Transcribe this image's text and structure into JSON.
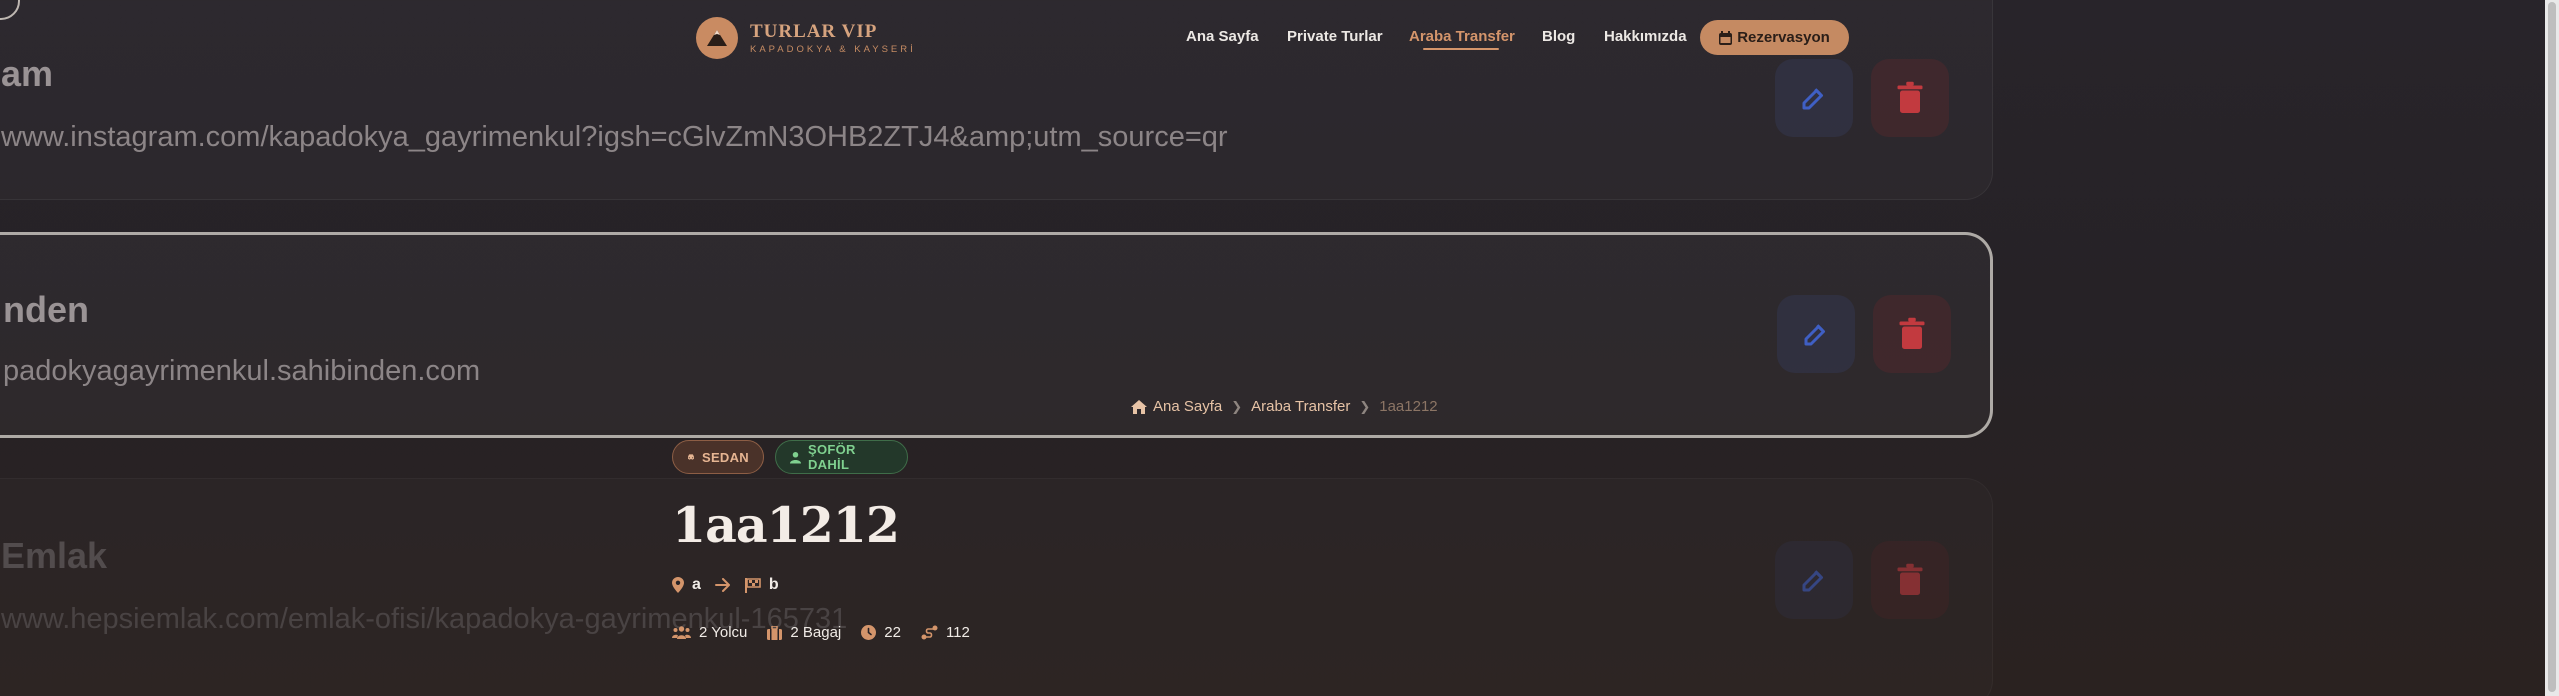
{
  "background_cards": [
    {
      "title": "am",
      "url": "www.instagram.com/kapadokya_gayrimenkul?igsh=cGlvZmN3OHB2ZTJ4&amp;utm_source=qr"
    },
    {
      "title": "nden",
      "url": "padokyagayrimenkul.sahibinden.com"
    },
    {
      "title": "Emlak",
      "url": "www.hepsiemlak.com/emlak-ofisi/kapadokya-gayrimenkul-165731"
    }
  ],
  "brand": {
    "title": "TURLAR VIP",
    "subtitle": "KAPADOKYA & KAYSERİ"
  },
  "nav": {
    "items": [
      {
        "label": "Ana Sayfa"
      },
      {
        "label": "Private Turlar"
      },
      {
        "label": "Araba Transfer"
      },
      {
        "label": "Blog"
      },
      {
        "label": "Hakkımızda"
      }
    ],
    "active_index": 2,
    "reserve_label": "Rezervasyon"
  },
  "breadcrumb": {
    "home": "Ana Sayfa",
    "section": "Araba Transfer",
    "current": "1aa1212"
  },
  "badges": {
    "vehicle": "SEDAN",
    "driver": "ŞOFÖR DAHİL"
  },
  "listing": {
    "title": "1aa1212",
    "from": "a",
    "to": "b",
    "passengers": "2 Yolcu",
    "luggage": "2 Bagaj",
    "duration": "22",
    "distance": "112"
  },
  "colors": {
    "accent": "#c58a62",
    "accent_text": "#d4956b",
    "success": "#7fd08f",
    "edit": "#3f5fc4",
    "delete": "#c23a3f"
  }
}
